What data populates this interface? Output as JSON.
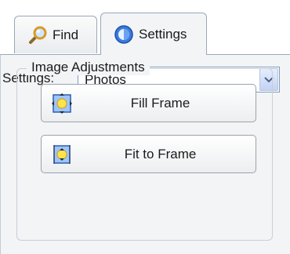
{
  "tabs": [
    {
      "label": "Find",
      "icon": "magnifier-icon",
      "active": false
    },
    {
      "label": "Settings",
      "icon": "settings-globe-icon",
      "active": true
    }
  ],
  "settings": {
    "label": "Settings:",
    "selected_value": "Photos"
  },
  "image_adjustments": {
    "group_title": "Image Adjustments",
    "buttons": [
      {
        "label": "Fill Frame",
        "icon": "fill-frame-icon"
      },
      {
        "label": "Fit to Frame",
        "icon": "fit-to-frame-icon"
      }
    ]
  },
  "colors": {
    "panel_bg": "#f2f4f6",
    "border": "#9aa7b8",
    "accent_blue": "#2f6fd0"
  }
}
